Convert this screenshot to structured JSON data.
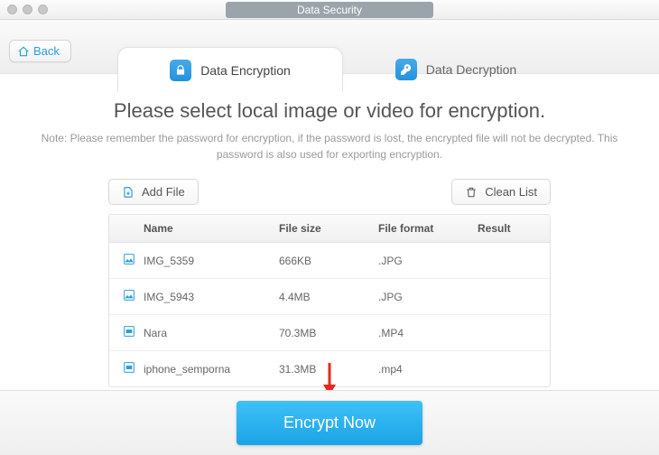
{
  "window": {
    "title": "Data Security"
  },
  "back": {
    "label": "Back"
  },
  "tabs": {
    "encrypt": "Data Encryption",
    "decrypt": "Data Decryption",
    "active": 0
  },
  "heading": "Please select local image or video for encryption.",
  "note": "Note: Please remember the password for encryption, if the password is lost, the encrypted file will not be decrypted. This password is also used for exporting encryption.",
  "buttons": {
    "add": "Add File",
    "clean": "Clean List"
  },
  "columns": {
    "name": "Name",
    "size": "File size",
    "format": "File format",
    "result": "Result"
  },
  "rows": [
    {
      "name": "IMG_5359",
      "size": "666KB",
      "format": ".JPG",
      "result": ""
    },
    {
      "name": "IMG_5943",
      "size": "4.4MB",
      "format": ".JPG",
      "result": ""
    },
    {
      "name": "Nara",
      "size": "70.3MB",
      "format": ".MP4",
      "result": ""
    },
    {
      "name": "iphone_semporna",
      "size": "31.3MB",
      "format": ".mp4",
      "result": ""
    }
  ],
  "cta": "Encrypt Now"
}
